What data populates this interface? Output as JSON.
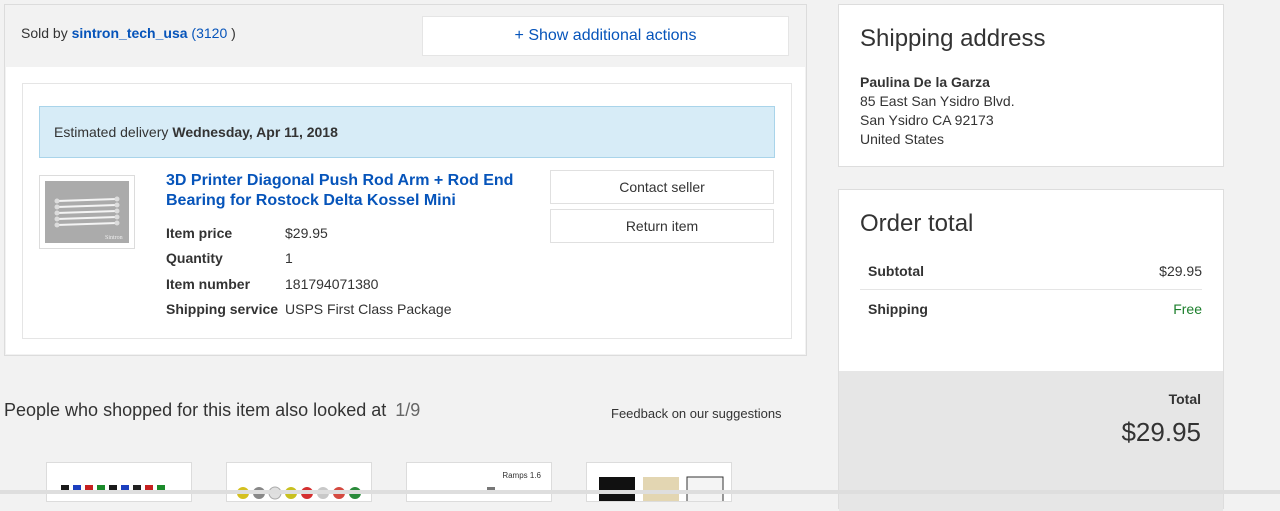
{
  "order": {
    "sold_by_prefix": "Sold by",
    "seller": "sintron_tech_usa",
    "feedback_open": "(",
    "feedback": "3120",
    "feedback_close": ")",
    "actions_label": "+ Show additional actions",
    "delivery_prefix": "Estimated delivery",
    "delivery_date": "Wednesday, Apr 11, 2018",
    "item": {
      "title": "3D Printer Diagonal Push Rod Arm + Rod End Bearing for Rostock Delta Kossel Mini",
      "thumb_watermark": "Sintron",
      "details": [
        {
          "label": "Item price",
          "value": "$29.95"
        },
        {
          "label": "Quantity",
          "value": "1"
        },
        {
          "label": "Item number",
          "value": "181794071380"
        },
        {
          "label": "Shipping service",
          "value": "USPS First Class Package"
        }
      ],
      "contact_label": "Contact seller",
      "return_label": "Return item"
    }
  },
  "recommendations": {
    "heading": "People who shopped for this item also looked at",
    "pager": "1/9",
    "feedback_link": "Feedback on our suggestions",
    "items": [
      {
        "label": ""
      },
      {
        "label": ""
      },
      {
        "label": "Ramps 1.6"
      },
      {
        "label": ""
      }
    ]
  },
  "shipping": {
    "title": "Shipping address",
    "name": "Paulina De la Garza",
    "line1": "85 East San Ysidro Blvd.",
    "line2": "San Ysidro CA 92173",
    "country": "United States"
  },
  "total": {
    "title": "Order total",
    "subtotal_label": "Subtotal",
    "subtotal_value": "$29.95",
    "shipping_label": "Shipping",
    "shipping_value": "Free",
    "total_label": "Total",
    "total_value": "$29.95"
  },
  "colors": {
    "link": "#0654ba",
    "delivery_bg": "#d7ecf7",
    "free": "#1c7f2c"
  }
}
